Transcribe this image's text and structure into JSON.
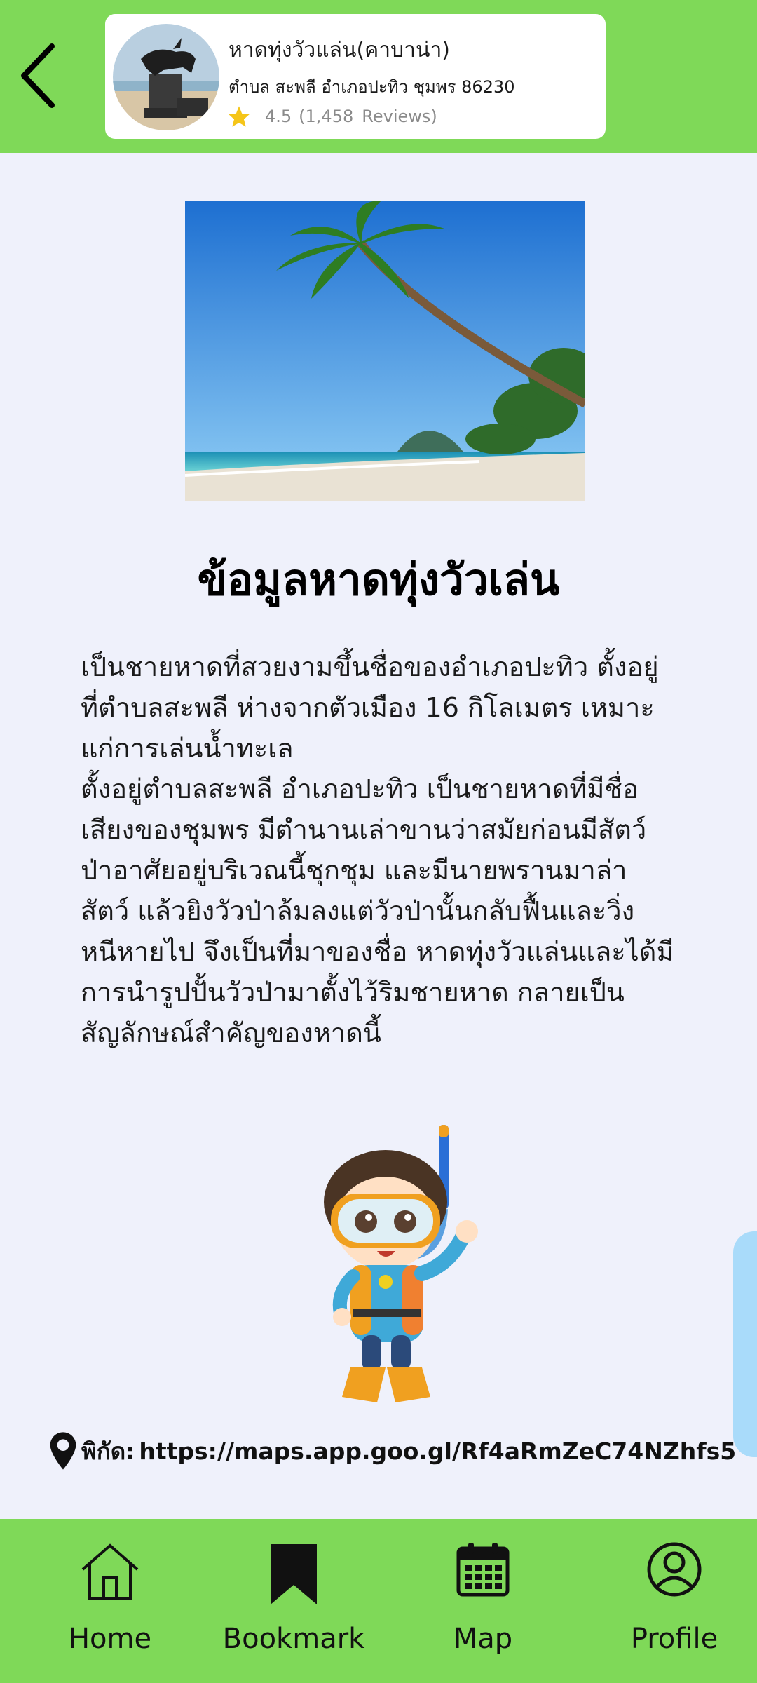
{
  "header": {
    "back_icon": "chevron-left-icon",
    "place": {
      "name": "หาดทุ่งวัวแล่น(คาบาน่า)",
      "address": "ตำบล สะพลี อำเภอปะทิว ชุมพร 86230",
      "rating": "4.5",
      "review_count": "(1,458",
      "reviews_label": "Reviews)",
      "star_color": "#f5c518"
    }
  },
  "main": {
    "title": "ข้อมูลหาดทุ่งวัวเล่น",
    "description": "เป็นชายหาดที่สวยงามขึ้นชื่อของอำเภอปะทิว ตั้งอยู่\nที่ตำบลสะพลี ห่างจากตัวเมือง 16 กิโลเมตร เหมาะ\nแก่การเล่นน้ำทะเล\nตั้งอยู่ตำบลสะพลี อำเภอปะทิว เป็นชายหาดที่มีชื่อ\nเสียงของชุมพร มีตำนานเล่าขานว่าสมัยก่อนมีสัตว์\nป่าอาศัยอยู่บริเวณนี้ชุกชุม และมีนายพรานมาล่า\nสัตว์ แล้วยิงวัวป่าล้มลงแต่วัวป่านั้นกลับฟื้นและวิ่ง\nหนีหายไป จึงเป็นที่มาของชื่อ หาดทุ่งวัวแล่นและได้มี\nการนำรูปปั้นวัวป่ามาตั้งไว้ริมชายหาด กลายเป็น\nสัญลักษณ์สำคัญของหาดนี้",
    "coordinates_label": "พิกัด:",
    "coordinates_link": "https://maps.app.goo.gl/Rf4aRmZeC74NZhfs5"
  },
  "bottom_nav": {
    "items": [
      {
        "label": "Home",
        "icon": "home-icon"
      },
      {
        "label": "Bookmark",
        "icon": "bookmark-icon"
      },
      {
        "label": "Map",
        "icon": "calendar-icon"
      },
      {
        "label": "Profile",
        "icon": "profile-icon"
      }
    ]
  },
  "colors": {
    "header_bg": "#7fd958",
    "page_bg": "#eff1fb",
    "side_tab": "#a9dbfa"
  }
}
